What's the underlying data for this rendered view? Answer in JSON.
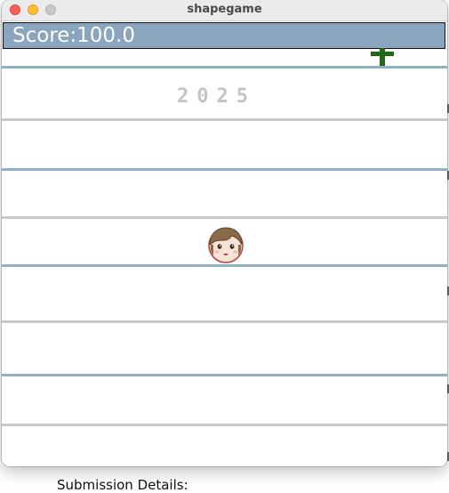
{
  "window": {
    "title": "shapegame"
  },
  "game": {
    "score_text": "Score:100.0",
    "year_text": "2025",
    "icons": {
      "pickup": "plus-icon",
      "player": "girl-face-icon"
    },
    "colors": {
      "scorebar": "#8aa5bd",
      "lane_blue": "#8fb1c6",
      "lane_gray": "#c9c9c9",
      "pickup": "#1f6a12"
    }
  },
  "background": {
    "label": "Submission Details:"
  }
}
